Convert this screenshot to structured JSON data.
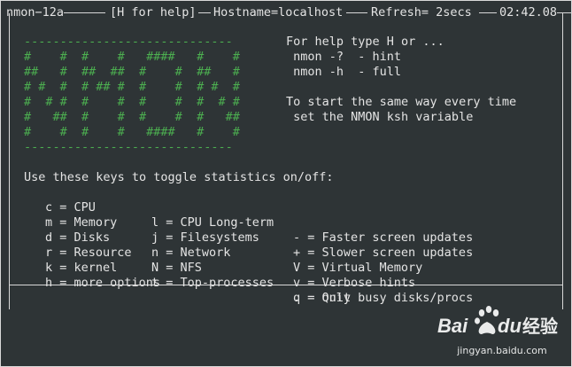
{
  "titlebar": {
    "left": "nmon−12a",
    "help": "[H for help]",
    "hostname": "Hostname=localhost",
    "refresh": "Refresh= 2secs",
    "time": "02:42.08"
  },
  "banner": [
    "-----------------------------",
    "#    #  #    #   ####   #    #",
    "##   #  ##  ##  #    #  ##   #",
    "# #  #  # ## #  #    #  # #  #",
    "#  # #  #    #  #    #  #  # #",
    "#   ##  #    #  #    #  #   ##",
    "#    #  #    #   ####   #    #",
    "-----------------------------"
  ],
  "help_hint": {
    "line1": "For help type H or ...",
    "line2": " nmon -?  - hint",
    "line3": " nmon -h  - full",
    "line4": "To start the same way every time",
    "line5": " set the NMON ksh variable"
  },
  "keys_heading": "Use these keys to toggle statistics on/off:",
  "keys": [
    [
      "c = CPU",
      "l = CPU Long-term",
      "- = Faster screen updates"
    ],
    [
      "m = Memory",
      "j = Filesystems",
      "+ = Slower screen updates"
    ],
    [
      "d = Disks",
      "n = Network",
      "V = Virtual Memory"
    ],
    [
      "r = Resource",
      "N = NFS",
      "v = Verbose hints"
    ],
    [
      "k = kernel",
      "t = Top-processes",
      ". = only busy disks/procs"
    ],
    [
      "h = more options",
      "",
      "q = Quit"
    ]
  ],
  "watermark": {
    "brand": "Bai du 经验",
    "url": "jingyan.baidu.com"
  },
  "colors": {
    "background": "#2e3436",
    "foreground": "#e4e4e4",
    "banner": "#4caf50"
  }
}
